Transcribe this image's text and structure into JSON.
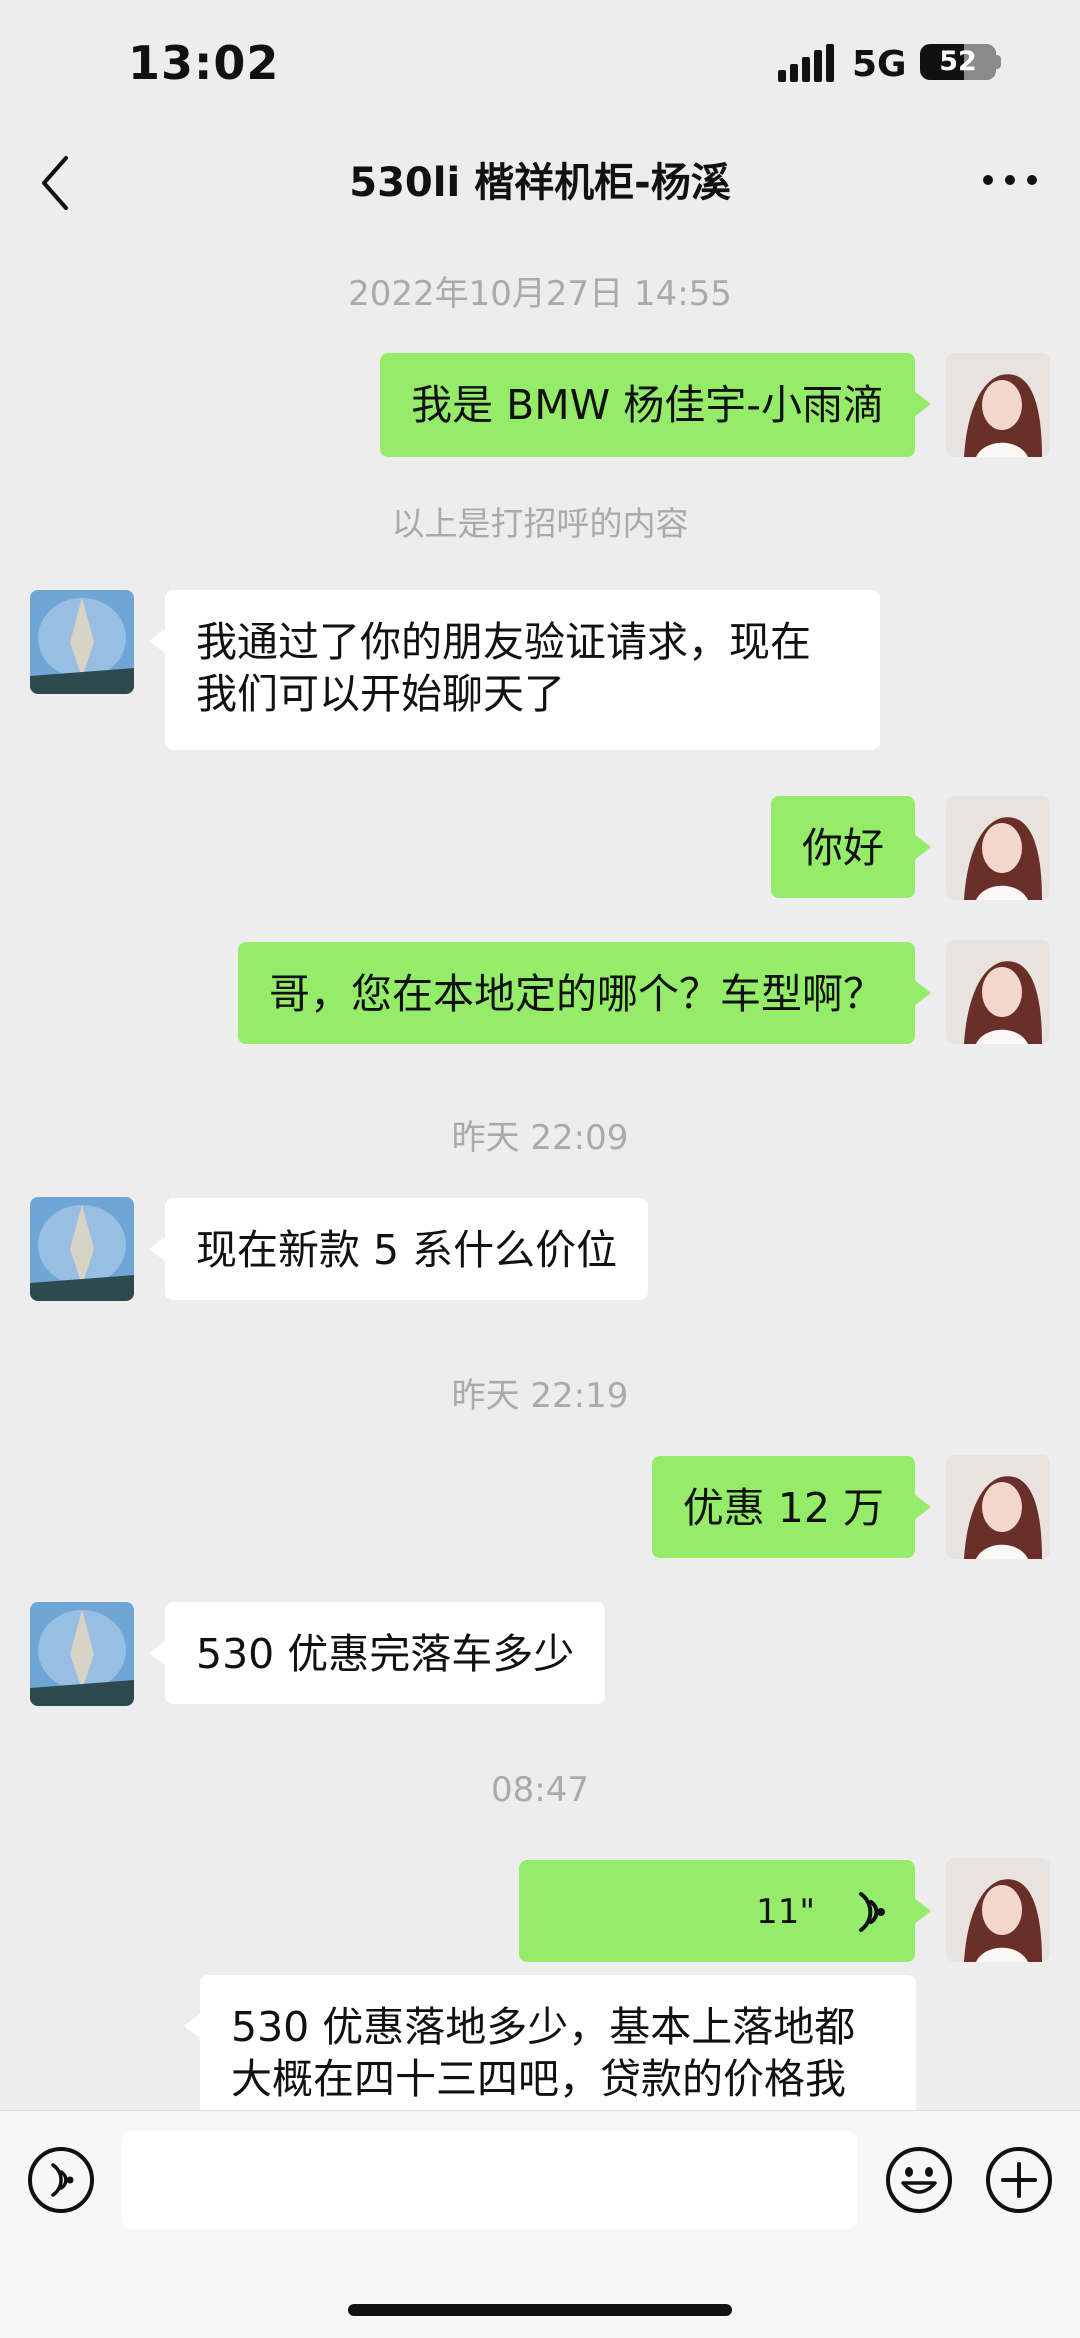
{
  "status_bar": {
    "time": "13:02",
    "network": "5G",
    "battery": "52"
  },
  "nav": {
    "title": "530li 楷祥机柜-杨溪"
  },
  "messages": {
    "ts1": "2022年10月27日 14:55",
    "m1": "我是 BMW 杨佳宇-小雨滴",
    "sys1": "以上是打招呼的内容",
    "m2": "我通过了你的朋友验证请求，现在我们可以开始聊天了",
    "m3": "你好",
    "m4": "哥，您在本地定的哪个？车型啊？",
    "ts2": "昨天 22:09",
    "m5": "现在新款 5 系什么价位",
    "ts3": "昨天 22:19",
    "m6": "优惠 12 万",
    "m7": "530 优惠完落车多少",
    "ts4": "08:47",
    "m8_duration": "11\"",
    "m9": "530 优惠落地多少，基本上落地都大概在四十三四吧，贷款的价格我"
  },
  "icons": {
    "back": "chevron-left-icon",
    "more": "more-dots-icon",
    "voice": "voice-wave-icon",
    "voice_mode": "voice-mode-icon",
    "emoji": "emoji-icon",
    "add": "plus-circle-icon"
  },
  "colors": {
    "my_bubble": "#95ec69",
    "their_bubble": "#ffffff",
    "background": "#ededed"
  }
}
